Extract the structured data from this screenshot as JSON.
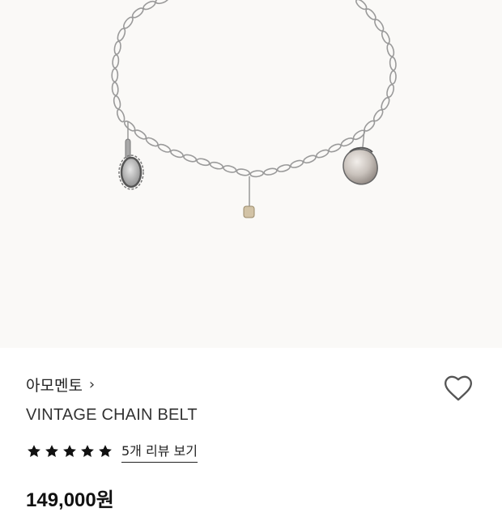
{
  "product": {
    "image_alt": "vintage chain belt product image"
  },
  "brand": {
    "name": "아모멘토",
    "chevron": "›"
  },
  "title": "VINTAGE CHAIN BELT",
  "rating": {
    "stars": 5,
    "review_link": "5개 리뷰 보기"
  },
  "price": "149,000원",
  "colors": {
    "image_bg": "#faf9f7",
    "chain": "#9a9a9a",
    "star": "#111111",
    "heart_outline": "#555555"
  },
  "icons": {
    "wishlist": "heart-outline-icon",
    "star": "star-icon",
    "chevron": "chevron-right-icon"
  }
}
